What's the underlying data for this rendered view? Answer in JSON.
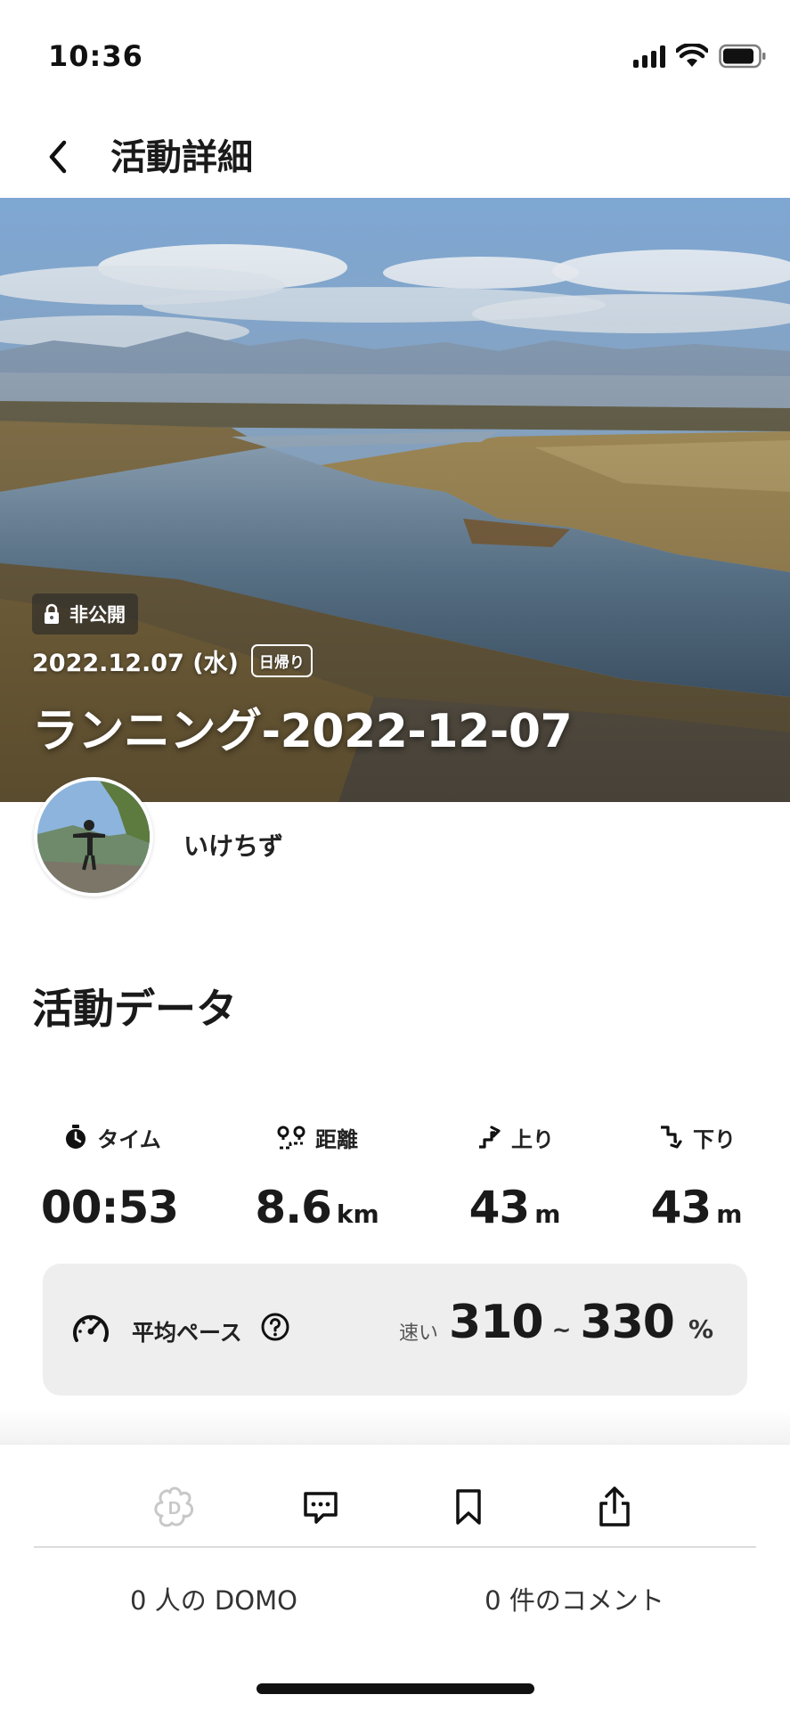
{
  "status_bar": {
    "time": "10:36"
  },
  "header": {
    "title": "活動詳細"
  },
  "hero": {
    "visibility_badge": "非公開",
    "date": "2022.12.07 (水)",
    "trip_tag": "日帰り",
    "activity_title": "ランニング-2022-12-07"
  },
  "user": {
    "name": "いけちず"
  },
  "activity_data": {
    "title": "活動データ",
    "stats": [
      {
        "label": "タイム",
        "value": "00:53",
        "unit": ""
      },
      {
        "label": "距離",
        "value": "8.6",
        "unit": "km"
      },
      {
        "label": "上り",
        "value": "43",
        "unit": "m"
      },
      {
        "label": "下り",
        "value": "43",
        "unit": "m"
      }
    ],
    "pace": {
      "label": "平均ペース",
      "speed_label": "速い",
      "min": "310",
      "separator": "~",
      "max": "330",
      "unit": "%"
    }
  },
  "bottom_bar": {
    "domo_count_label": "0 人の DOMO",
    "comment_count_label": "0 件のコメント"
  },
  "colors": {
    "accent": "#1a1a1a",
    "card_bg": "#eeeeee",
    "disabled_icon": "#c8c8c8"
  }
}
